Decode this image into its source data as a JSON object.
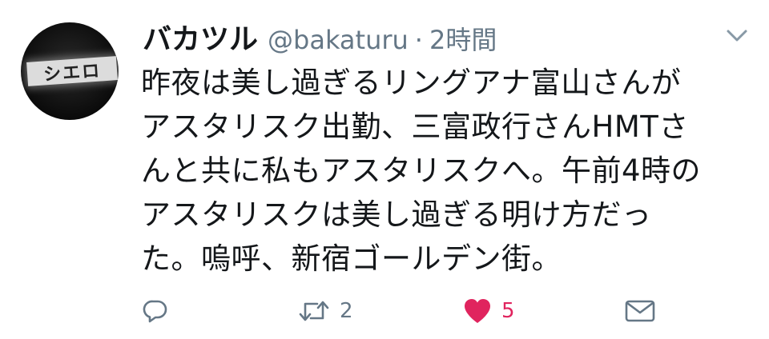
{
  "tweet": {
    "display_name": "バカツル",
    "handle": "@bakaturu",
    "separator": "·",
    "time": "2時間",
    "text": "昨夜は美し過ぎるリングアナ富山さんが\nアスタリスク出勤、三富政行さんHMTさ\nんと共に私もアスタリスクへ。午前4時の\nアスタリスクは美し過ぎる明け方だっ\nた。嗚呼、新宿ゴールデン街。",
    "avatar_sign_text": "シエロ"
  },
  "actions": {
    "reply_icon": "reply-icon",
    "retweet_icon": "retweet-icon",
    "retweet_count": "2",
    "like_icon": "heart-icon",
    "like_count": "5",
    "dm_icon": "envelope-icon"
  },
  "colors": {
    "text": "#14171a",
    "secondary": "#657786",
    "like": "#e0245e",
    "background": "#ffffff"
  }
}
